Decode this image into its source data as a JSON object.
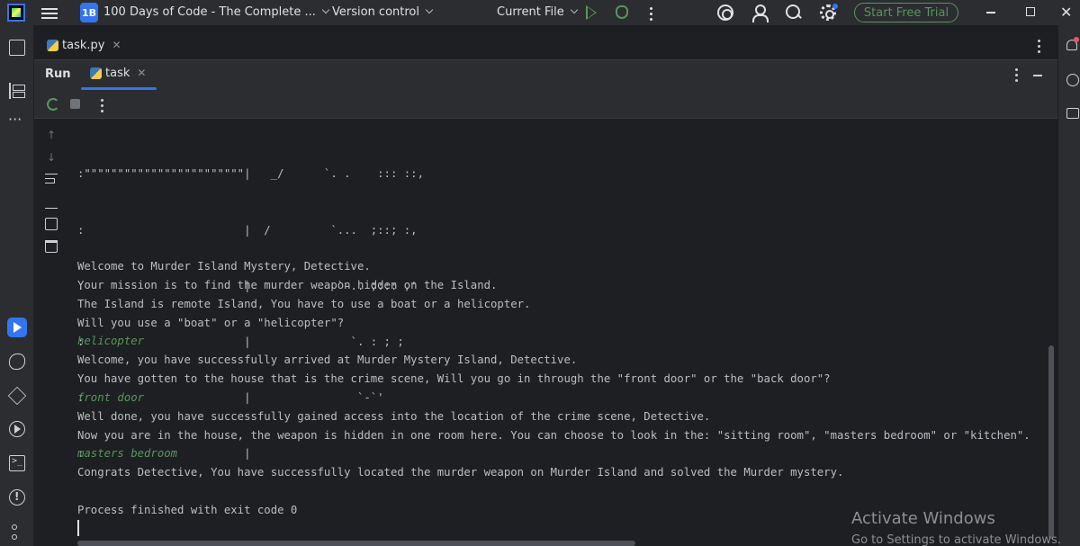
{
  "titlebar": {
    "project_badge": "1B",
    "project_name": "100 Days of Code - The Complete ...",
    "version_control": "Version control",
    "current_file": "Current File",
    "trial_button": "Start Free Trial"
  },
  "editor_tab": {
    "filename": "task.py"
  },
  "run_panel": {
    "title": "Run",
    "tab_label": "task"
  },
  "console": {
    "ascii_art": [
      ":\"\"\"\"\"\"\"\"\"\"\"\"\"\"\"\"\"\"\"\"\"\"\"\"|   _/      `. .    ::: ::,",
      ":                        |  /         `...  ;::; :,",
      ":                        |             `-.. ;::: ,'",
      ":                        |               `. : ; ;",
      ":                        |                `-`'",
      ":                        |"
    ],
    "lines": [
      {
        "text": "Welcome to Murder Island Mystery, Detective.",
        "type": "output"
      },
      {
        "text": "Your mission is to find the murder weapon hidden on the Island.",
        "type": "output"
      },
      {
        "text": "The Island is remote Island, You have to use a boat or a helicopter.",
        "type": "output"
      },
      {
        "text": "Will you use a \"boat\" or a \"helicopter\"?",
        "type": "output"
      },
      {
        "text": "helicopter",
        "type": "input"
      },
      {
        "text": "Welcome, you have successfully arrived at Murder Mystery Island, Detective.",
        "type": "output"
      },
      {
        "text": "You have gotten to the house that is the crime scene, Will you go in through the \"front door\" or the \"back door\"?",
        "type": "output"
      },
      {
        "text": "front door",
        "type": "input"
      },
      {
        "text": "Well done, you have successfully gained access into the location of the crime scene, Detective.",
        "type": "output"
      },
      {
        "text": "Now you are in the house, the weapon is hidden in one room here. You can choose to look in the: \"sitting room\", \"masters bedroom\" or \"kitchen\".",
        "type": "output"
      },
      {
        "text": "masters bedroom",
        "type": "input"
      },
      {
        "text": "Congrats Detective, You have successfully located the murder weapon on Murder Island and solved the Murder mystery.",
        "type": "output"
      },
      {
        "text": "",
        "type": "output"
      },
      {
        "text": "Process finished with exit code 0",
        "type": "output"
      }
    ]
  },
  "watermark": {
    "title": "Activate Windows",
    "subtitle": "Go to Settings to activate Windows."
  },
  "colors": {
    "accent": "#3574f0",
    "run_green": "#57965c",
    "background": "#1e1f22",
    "panel": "#2b2d30"
  },
  "icons": [
    "app-logo-icon",
    "hamburger-icon",
    "chevron-down-icon",
    "run-icon",
    "debug-icon",
    "more-vertical-icon",
    "ai-assistant-icon",
    "add-user-icon",
    "search-icon",
    "gear-icon",
    "minimize-icon",
    "maximize-icon",
    "close-icon",
    "folder-icon",
    "structure-icon",
    "python-icon",
    "rerun-icon",
    "stop-icon",
    "scroll-up-icon",
    "scroll-down-icon",
    "soft-wrap-icon",
    "scroll-to-end-icon",
    "print-icon",
    "trash-icon",
    "bell-icon",
    "database-icon"
  ]
}
